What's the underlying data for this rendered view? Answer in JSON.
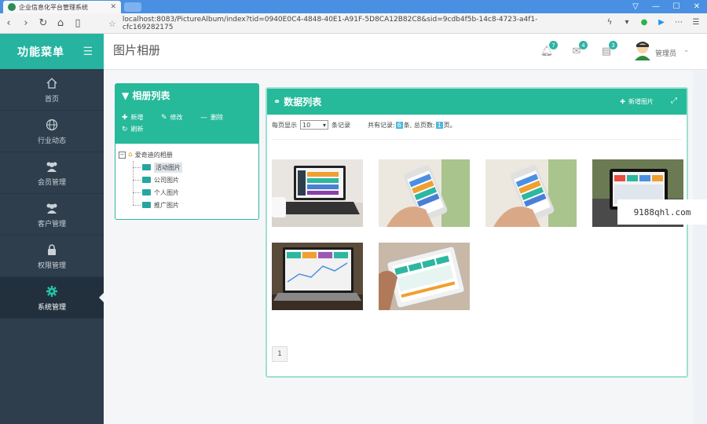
{
  "browser": {
    "tab_title": "企业信息化平台管理系统",
    "url": "localhost:8083/PictureAlbum/index?tid=0940E0C4-4848-40E1-A91F-5D8CA12B82C8&sid=9cdb4f5b-14c8-4723-a4f1-cfc169282175"
  },
  "sidebar": {
    "title": "功能菜单",
    "items": [
      {
        "label": "首页",
        "icon": "home-icon"
      },
      {
        "label": "行业动态",
        "icon": "globe-icon"
      },
      {
        "label": "会员管理",
        "icon": "users-icon"
      },
      {
        "label": "客户管理",
        "icon": "users-icon"
      },
      {
        "label": "权限管理",
        "icon": "lock-icon"
      },
      {
        "label": "系统管理",
        "icon": "gear-icon"
      }
    ],
    "active_index": 5
  },
  "header": {
    "page_title": "图片相册",
    "notifications": [
      {
        "icon": "bell-icon",
        "count": "7"
      },
      {
        "icon": "mail-icon",
        "count": "4"
      },
      {
        "icon": "task-icon",
        "count": "3"
      }
    ],
    "username": "管理员"
  },
  "album_panel": {
    "title": "相册列表",
    "tools": [
      {
        "label": "新增",
        "icon": "plus-icon"
      },
      {
        "label": "修改",
        "icon": "pencil-icon"
      },
      {
        "label": "删除",
        "icon": "minus-icon"
      },
      {
        "label": "刷新",
        "icon": "refresh-icon"
      }
    ],
    "tree": {
      "root": "爱奇迪的相册",
      "children": [
        "活动图片",
        "公司图片",
        "个人图片",
        "推广图片"
      ],
      "selected_index": 0
    }
  },
  "data_panel": {
    "title": "数据列表",
    "add_label": "新增图片",
    "page_size_prefix": "每页显示",
    "page_size_value": "10",
    "page_size_suffix": "条记录",
    "total_prefix": "共有记录:",
    "total_records": "6",
    "total_mid": "条, 总页数:",
    "total_pages": "1",
    "total_suffix": "页。",
    "current_page": "1"
  },
  "watermark": "9188qhl.com"
}
